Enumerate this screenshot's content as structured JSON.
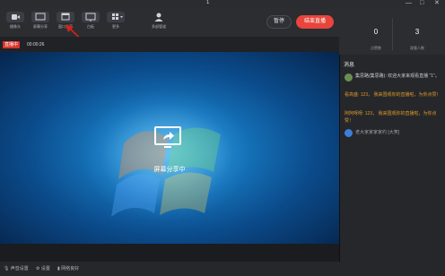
{
  "titlebar": {
    "number": "1",
    "controls": [
      "—",
      "□",
      "✕"
    ]
  },
  "toolbar": {
    "tools": [
      {
        "label": "摄像头",
        "icon": "camera-icon"
      },
      {
        "label": "屏幕分享",
        "icon": "screen-share-icon"
      },
      {
        "label": "窗口分享",
        "icon": "window-share-icon"
      },
      {
        "label": "白板",
        "icon": "whiteboard-icon"
      },
      {
        "label": "更多",
        "icon": "grid-icon"
      },
      {
        "label": "多部管道",
        "icon": "user-icon"
      }
    ],
    "pause_label": "暂停",
    "end_label": "结束直播"
  },
  "status": {
    "live_badge": "直播中",
    "time": "00:00:26"
  },
  "video": {
    "share_text": "屏幕分享中"
  },
  "stats": {
    "items": [
      {
        "value": "0",
        "label": "点赞数"
      },
      {
        "value": "3",
        "label": "观看人数"
      }
    ]
  },
  "messages": {
    "title": "消息",
    "items": [
      {
        "text": "集思路(集思路): 欢迎大家来观看直播 \"1\"。",
        "color": "#c9ccd1"
      },
      {
        "text": "看高盛: 123， 我来围观你的直播啦，为你点赞！",
        "color": "#e0982a"
      },
      {
        "text": "阿阿呀呀: 123， 我来围观你的直播啦，为你点赞！",
        "color": "#e0982a"
      },
      {
        "text": "老大家家家家约 [大笑]",
        "color": "#9ea2a8"
      }
    ]
  },
  "footer": {
    "items": [
      "声音设置",
      "设置",
      "网络良好"
    ]
  },
  "colors": {
    "accent": "#e8453c",
    "highlight_text": "#e0982a",
    "background": "#1d1f23"
  }
}
